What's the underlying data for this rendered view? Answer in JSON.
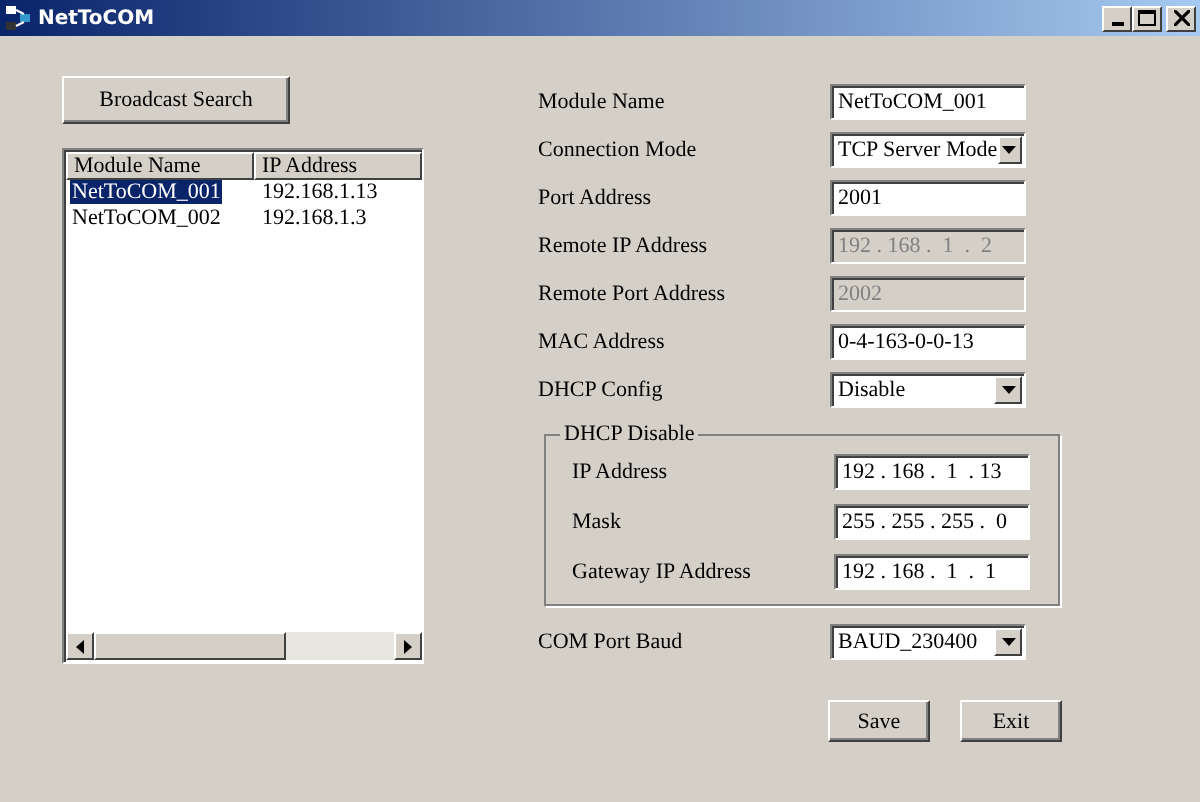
{
  "window": {
    "title": "NetToCOM"
  },
  "broadcast_button": "Broadcast Search",
  "module_list": {
    "columns": [
      "Module Name",
      "IP Address"
    ],
    "rows": [
      {
        "cells": [
          "NetToCOM_001",
          "192.168.1.13"
        ],
        "selected": true
      },
      {
        "cells": [
          "NetToCOM_002",
          "192.168.1.3"
        ],
        "selected": false
      }
    ]
  },
  "fields": [
    {
      "label": "Module Name",
      "kind": "text",
      "value": "NetToCOM_001",
      "disabled": false
    },
    {
      "label": "Connection Mode",
      "kind": "combo",
      "value": "TCP Server Mode",
      "disabled": false
    },
    {
      "label": "Port Address",
      "kind": "text",
      "value": "2001",
      "disabled": false
    },
    {
      "label": "Remote IP Address",
      "kind": "ip",
      "value": "192 . 168 .  1  .  2",
      "disabled": true
    },
    {
      "label": "Remote Port Address",
      "kind": "text",
      "value": "2002",
      "disabled": true
    },
    {
      "label": "MAC Address",
      "kind": "text",
      "value": "0-4-163-0-0-13",
      "disabled": false
    },
    {
      "label": "DHCP Config",
      "kind": "combo",
      "value": "Disable",
      "disabled": false
    }
  ],
  "dhcp_group": {
    "title": "DHCP Disable",
    "fields": [
      {
        "label": "IP Address",
        "value": "192 . 168 .  1  . 13",
        "disabled": false
      },
      {
        "label": "Mask",
        "value": "255 . 255 . 255 .  0",
        "disabled": false
      },
      {
        "label": "Gateway IP Address",
        "value": "192 . 168 .  1  .  1",
        "disabled": false
      }
    ]
  },
  "com_port": {
    "label": "COM Port Baud",
    "kind": "combo",
    "value": "BAUD_230400",
    "disabled": false
  },
  "buttons": [
    "Save",
    "Exit"
  ]
}
